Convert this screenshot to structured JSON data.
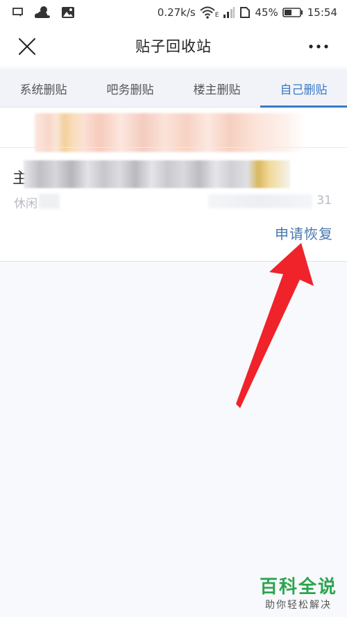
{
  "status_bar": {
    "net_speed": "0.27k/s",
    "network_type": "E",
    "battery": "45%",
    "time": "15:54",
    "icons": [
      "message-icon",
      "weather-cloud-icon",
      "image-icon",
      "wifi-icon",
      "signal-icon",
      "sim-icon",
      "battery-icon"
    ]
  },
  "header": {
    "title": "贴子回收站",
    "close_icon": "close-icon",
    "more_icon": "more-icon"
  },
  "tabs": [
    {
      "label": "系统删贴",
      "active": false
    },
    {
      "label": "吧务删贴",
      "active": false
    },
    {
      "label": "楼主删贴",
      "active": false
    },
    {
      "label": "自己删贴",
      "active": true
    }
  ],
  "post": {
    "title_visible": "主",
    "meta_left": "休闲",
    "meta_right": "31",
    "restore_label": "申请恢复"
  },
  "colors": {
    "accent": "#3a78c7",
    "restore": "#4676ad",
    "arrow": "#f0222a",
    "watermark": "#2ea44f"
  },
  "watermark": {
    "title": "百科全说",
    "subtitle": "助你轻松解决"
  }
}
